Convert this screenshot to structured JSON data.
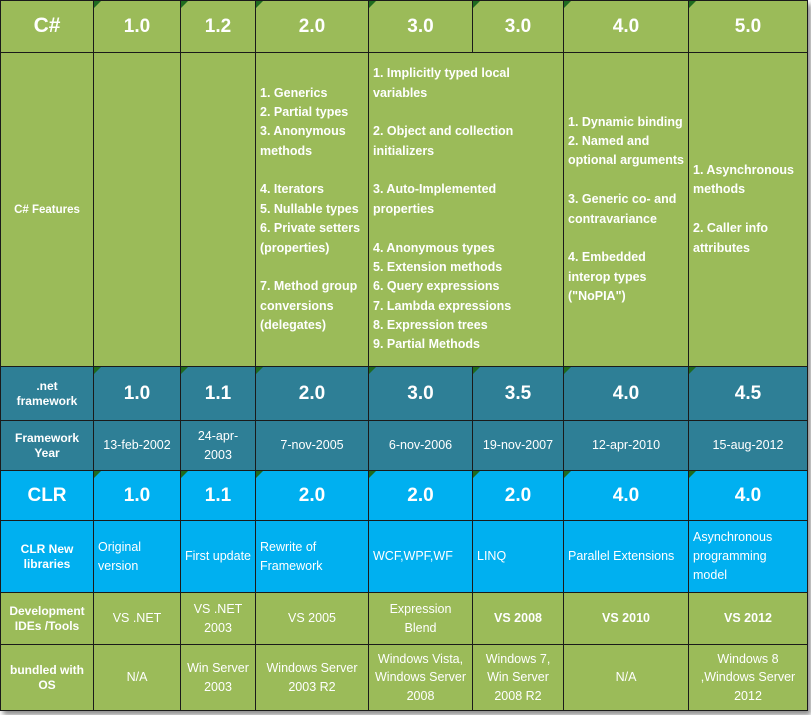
{
  "table": {
    "columns": [
      "C#",
      "1.0",
      "1.2",
      "2.0",
      "3.0",
      "3.0",
      "4.0",
      "5.0"
    ],
    "row_labels": {
      "csharp_version": "C#",
      "csharp_features": "C# Features",
      "net_framework": ".net\nframework",
      "framework_year": "Framework\nYear",
      "clr": "CLR",
      "clr_new_libraries": "CLR New\nlibraries",
      "dev_ides_tools": "Development\nIDEs /Tools",
      "bundled_with_os": "bundled with\nOS"
    },
    "csharp_versions": {
      "v1_0": "1.0",
      "v1_2": "1.2",
      "v2_0": "2.0",
      "v3_0": "3.0",
      "v3_0b": "3.0",
      "v4_0": "4.0",
      "v5_0": "5.0"
    },
    "csharp_features": {
      "v1_0": "",
      "v1_2": "",
      "v2_0": "1. Generics\n2. Partial types\n3. Anonymous methods\n\n4. Iterators\n5. Nullable types\n6. Private setters (properties)\n\n7. Method group conversions (delegates)",
      "v3_0": "1. Implicitly typed local variables\n\n2. Object and collection initializers\n\n3. Auto-Implemented properties\n\n4. Anonymous types\n5. Extension methods\n6. Query expressions\n7. Lambda expressions\n8. Expression trees\n9. Partial Methods",
      "v4_0": "1. Dynamic binding\n2. Named and optional arguments\n\n3. Generic co- and contravariance\n\n4. Embedded interop types (\"NoPIA\")",
      "v5_0": "1. Asynchronous methods\n\n2. Caller info attributes"
    },
    "net_framework": {
      "c1": "1.0",
      "c2": "1.1",
      "c3": "2.0",
      "c4": "3.0",
      "c5": "3.5",
      "c6": "4.0",
      "c7": "4.5"
    },
    "framework_year": {
      "c1": "13-feb-2002",
      "c2": "24-apr-2003",
      "c3": "7-nov-2005",
      "c4": "6-nov-2006",
      "c5": "19-nov-2007",
      "c6": "12-apr-2010",
      "c7": "15-aug-2012"
    },
    "clr": {
      "c1": "1.0",
      "c2": "1.1",
      "c3": "2.0",
      "c4": "2.0",
      "c5": "2.0",
      "c6": "4.0",
      "c7": "4.0"
    },
    "clr_new_libraries": {
      "c1": "Original version",
      "c2": "First update",
      "c3": "Rewrite of Framework",
      "c4": "WCF,WPF,WF",
      "c5": "LINQ",
      "c6": "Parallel Extensions",
      "c7": "Asynchronous programming model"
    },
    "dev_ides_tools": {
      "c1": "VS .NET",
      "c2": "VS .NET 2003",
      "c3": "VS 2005",
      "c4": "Expression Blend",
      "c5": "VS 2008",
      "c6": "VS 2010",
      "c7": "VS 2012"
    },
    "bundled_with_os": {
      "c1": "N/A",
      "c2": "Win Server 2003",
      "c3": "Windows Server 2003 R2",
      "c4": "Windows Vista, Windows Server 2008",
      "c5": "Windows 7, Win Server 2008 R2",
      "c6": "N/A",
      "c7": "Windows 8 ,Windows Server 2012"
    }
  },
  "colors": {
    "green": "#9BBB59",
    "teal": "#2E7F96",
    "cyan": "#00B0F0",
    "text": "#FFFFFF",
    "border": "#1A1A1A",
    "marker": "#1F6B1F"
  }
}
